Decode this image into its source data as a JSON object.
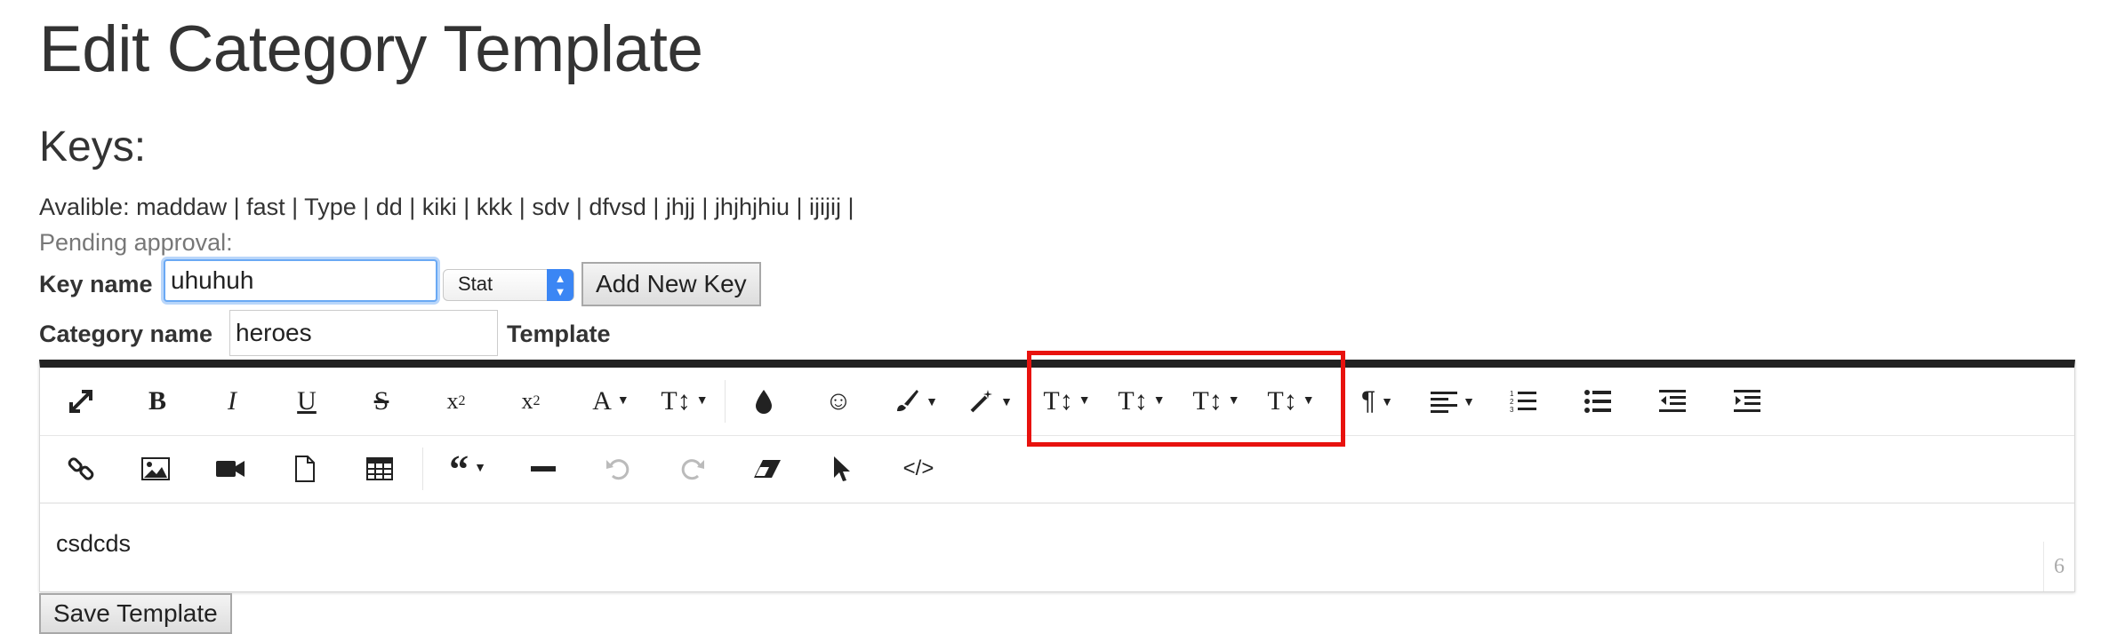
{
  "page": {
    "title": "Edit Category Template"
  },
  "keys": {
    "heading": "Keys:",
    "available": "Avalible: maddaw | fast | Type | dd | kiki | kkk | sdv | dfvsd | jhjj | jhjhjhiu | ijijij |",
    "pending": "Pending approval:"
  },
  "form": {
    "key_name_label": "Key name",
    "key_name_value": "uhuhuh",
    "type_selected": "Stat",
    "add_key_label": "Add New Key",
    "category_name_label": "Category name",
    "category_name_value": "heroes",
    "template_label": "Template",
    "save_label": "Save Template"
  },
  "editor": {
    "content": "csdcds",
    "resize_count": "6",
    "toolbar_row1": [
      {
        "icon": "fullscreen-icon",
        "glyph": "⤢"
      },
      {
        "icon": "bold-icon",
        "glyph": "B"
      },
      {
        "icon": "italic-icon",
        "glyph": "I"
      },
      {
        "icon": "underline-icon",
        "glyph": "U"
      },
      {
        "icon": "strikethrough-icon",
        "glyph": "S"
      },
      {
        "icon": "subscript-icon",
        "glyph": "x₂"
      },
      {
        "icon": "superscript-icon",
        "glyph": "x²"
      },
      {
        "icon": "font-family-icon",
        "glyph": "A"
      },
      {
        "icon": "font-size-icon",
        "glyph": "T↕"
      },
      {
        "icon": "text-color-icon",
        "glyph": "💧"
      },
      {
        "icon": "emoticon-icon",
        "glyph": "☺"
      },
      {
        "icon": "paint-brush-icon",
        "glyph": "🖌"
      },
      {
        "icon": "magic-wand-icon",
        "glyph": "✨"
      },
      {
        "icon": "line-height-icon-1",
        "glyph": "T↕"
      },
      {
        "icon": "line-height-icon-2",
        "glyph": "T↕"
      },
      {
        "icon": "line-height-icon-3",
        "glyph": "T↕"
      },
      {
        "icon": "line-height-icon-4",
        "glyph": "T↕"
      },
      {
        "icon": "paragraph-icon",
        "glyph": "¶"
      },
      {
        "icon": "align-icon",
        "glyph": "≡"
      },
      {
        "icon": "ordered-list-icon",
        "glyph": "☰"
      },
      {
        "icon": "unordered-list-icon",
        "glyph": "☰"
      },
      {
        "icon": "outdent-icon",
        "glyph": "⇤"
      },
      {
        "icon": "indent-icon",
        "glyph": "⇥"
      }
    ],
    "toolbar_row2": [
      {
        "icon": "link-icon",
        "glyph": "🔗"
      },
      {
        "icon": "image-icon",
        "glyph": "▣"
      },
      {
        "icon": "video-icon",
        "glyph": "■"
      },
      {
        "icon": "file-icon",
        "glyph": "▯"
      },
      {
        "icon": "table-icon",
        "glyph": "▦"
      },
      {
        "icon": "quote-icon",
        "glyph": "❝"
      },
      {
        "icon": "horizontal-rule-icon",
        "glyph": "━"
      },
      {
        "icon": "undo-icon",
        "glyph": "↶"
      },
      {
        "icon": "redo-icon",
        "glyph": "↷"
      },
      {
        "icon": "eraser-icon",
        "glyph": "▱"
      },
      {
        "icon": "select-pointer-icon",
        "glyph": "➤"
      },
      {
        "icon": "code-view-icon",
        "glyph": "</>"
      }
    ]
  },
  "highlight": {
    "color": "#e8120e"
  },
  "colors": {
    "focus": "#6aa9f4",
    "select_arrow": "#3b86f4",
    "editor_top": "#222222"
  }
}
